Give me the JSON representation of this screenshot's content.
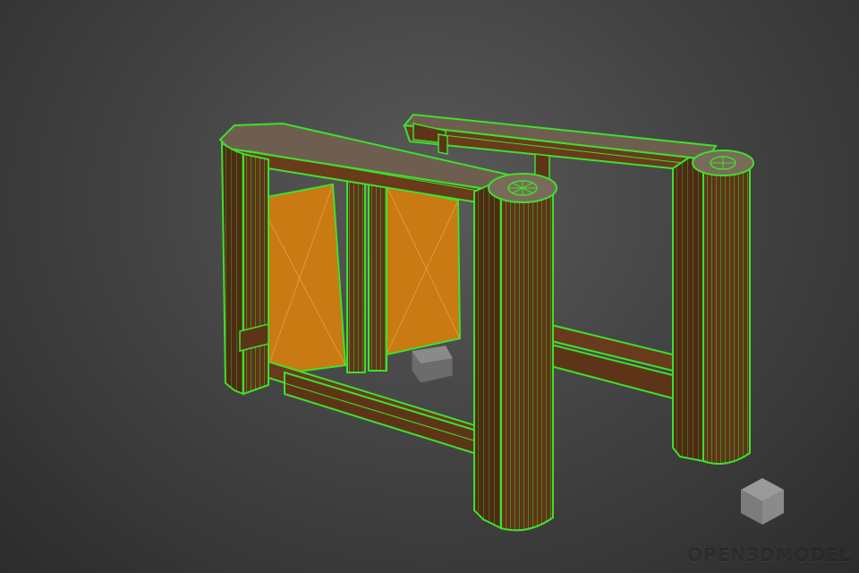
{
  "viewport": {
    "scene_subject": "turnstile-gate-wireframe-model",
    "colors": {
      "background": "#444444",
      "wireframe": "#39e52a",
      "body": "#6b3a1c",
      "panel": "#c97a12",
      "top_surface": "#7a6a5a"
    }
  },
  "watermark": {
    "text": "OPEN3DMODEL",
    "icon": "cube-icon"
  }
}
